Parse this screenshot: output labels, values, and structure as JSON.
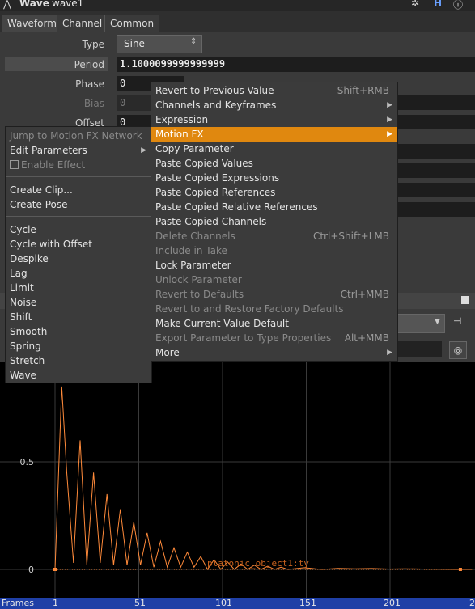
{
  "title": {
    "node_type": "Wave",
    "node_name": "wave1"
  },
  "tabs": [
    "Waveform",
    "Channel",
    "Common"
  ],
  "params": {
    "type_label": "Type",
    "type_value": "Sine",
    "period_label": "Period",
    "period_value": "1.1000099999999999",
    "phase_label": "Phase",
    "phase_value": "0",
    "bias_label": "Bias",
    "bias_value": "0",
    "offset_label": "Offset",
    "offset_value": "0"
  },
  "left_menu": {
    "items": [
      {
        "label": "Jump to Motion FX Network",
        "disabled": true
      },
      {
        "label": "Edit Parameters",
        "submenu": true
      },
      {
        "label": "Enable Effect",
        "checkbox": true,
        "disabled": true
      },
      {
        "label": "Create Clip..."
      },
      {
        "label": "Create Pose"
      },
      {
        "label": "Cycle"
      },
      {
        "label": "Cycle with Offset"
      },
      {
        "label": "Despike"
      },
      {
        "label": "Lag"
      },
      {
        "label": "Limit"
      },
      {
        "label": "Noise"
      },
      {
        "label": "Shift"
      },
      {
        "label": "Smooth"
      },
      {
        "label": "Spring"
      },
      {
        "label": "Stretch"
      },
      {
        "label": "Wave"
      }
    ]
  },
  "right_menu": {
    "items": [
      {
        "label": "Revert to Previous Value",
        "shortcut": "Shift+RMB"
      },
      {
        "label": "Channels and Keyframes",
        "submenu": true
      },
      {
        "label": "Expression",
        "submenu": true
      },
      {
        "label": "Motion FX",
        "submenu": true,
        "highlighted": true
      },
      {
        "label": "Copy Parameter"
      },
      {
        "label": "Paste Copied Values"
      },
      {
        "label": "Paste Copied Expressions"
      },
      {
        "label": "Paste Copied References"
      },
      {
        "label": "Paste Copied Relative References"
      },
      {
        "label": "Paste Copied Channels"
      },
      {
        "label": "Delete Channels",
        "shortcut": "Ctrl+Shift+LMB",
        "disabled": true
      },
      {
        "label": "Include in Take",
        "disabled": true
      },
      {
        "label": "Lock Parameter"
      },
      {
        "label": "Unlock Parameter",
        "disabled": true
      },
      {
        "label": "Revert to Defaults",
        "shortcut": "Ctrl+MMB",
        "disabled": true
      },
      {
        "label": "Revert to and Restore Factory Defaults",
        "disabled": true
      },
      {
        "label": "Make Current Value Default"
      },
      {
        "label": "Export Parameter to Type Properties",
        "shortcut": "Alt+MMB",
        "disabled": true
      },
      {
        "label": "More",
        "submenu": true
      }
    ]
  },
  "chart_data": {
    "type": "line",
    "series": [
      {
        "name": "platonic_object1:ty",
        "x": [
          1,
          5,
          8,
          12,
          16,
          20,
          24,
          28,
          32,
          36,
          40,
          44,
          48,
          52,
          56,
          60,
          64,
          68,
          72,
          76,
          80,
          84,
          88,
          92,
          96,
          100,
          104,
          108,
          112,
          116,
          120,
          124,
          128,
          132,
          136,
          140,
          150,
          160,
          170,
          180,
          190,
          200,
          210,
          220,
          230,
          240,
          250
        ],
        "y": [
          0,
          0.85,
          0.45,
          0.03,
          0.6,
          0.02,
          0.45,
          0.03,
          0.35,
          0.02,
          0.28,
          0.02,
          0.22,
          0.02,
          0.17,
          0.01,
          0.13,
          0.01,
          0.1,
          0.01,
          0.08,
          0.01,
          0.06,
          0,
          0.045,
          0,
          0.035,
          0,
          0.025,
          0,
          0.02,
          0,
          0.015,
          0,
          0.01,
          0,
          0.008,
          0,
          0.005,
          0.003,
          0.004,
          0.002,
          0.003,
          0.002,
          0.001,
          0,
          0
        ]
      }
    ],
    "ytick_labels": [
      "0",
      "0.5"
    ],
    "xtick_labels": [
      "1",
      "51",
      "101",
      "151",
      "201"
    ],
    "ylim": [
      0,
      1
    ],
    "xlim": [
      1,
      251
    ],
    "series_color": "#ff8a3a"
  },
  "footer": {
    "axis_label": "Frames",
    "frame_labels": [
      "1",
      "51",
      "101",
      "151",
      "201",
      "2"
    ]
  },
  "colors": {
    "highlight": "#e0880f",
    "footer_bg": "#1f3fa6",
    "curve": "#ff8a3a"
  }
}
